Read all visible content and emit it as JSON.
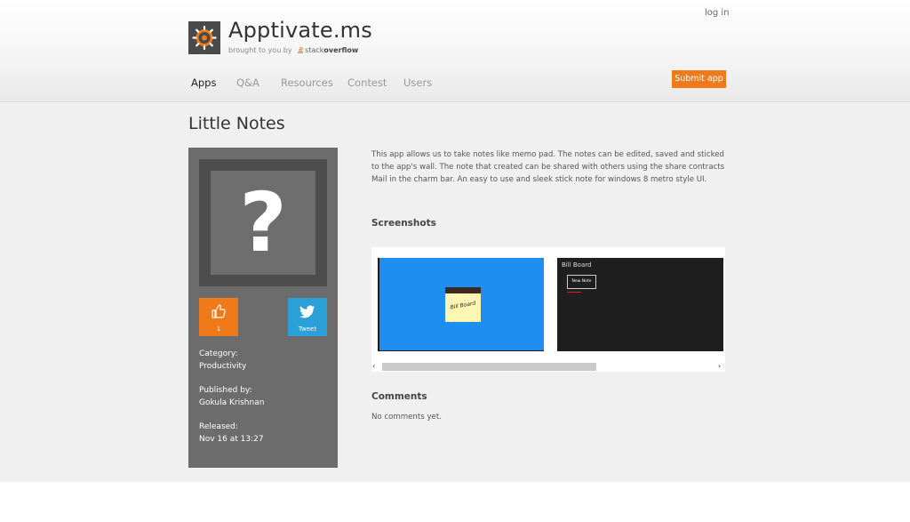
{
  "header": {
    "site_title": "Apptivate.ms",
    "brought_by": "brought to you by",
    "brand_stack": "stack",
    "brand_overflow": "overflow",
    "login": "log in",
    "logo_icon": "gear-icon",
    "nav": [
      {
        "label": "Apps",
        "active": true
      },
      {
        "label": "Q&A",
        "active": false
      },
      {
        "label": "Resources",
        "active": false
      },
      {
        "label": "Contest",
        "active": false
      },
      {
        "label": "Users",
        "active": false
      }
    ],
    "submit_label": "Submit app",
    "accent_color": "#f07a1a"
  },
  "app": {
    "title": "Little Notes",
    "placeholder_icon": "?",
    "likes": "1",
    "like_icon": "thumbs-up-icon",
    "tweet_label": "Tweet",
    "tweet_icon": "twitter-bird-icon",
    "category_label": "Category:",
    "category": "Productivity",
    "published_label": "Published by:",
    "publisher": "Gokula Krishnan",
    "released_label": "Released:",
    "released": "Nov 16 at 13:27",
    "description": "This app allows us to take notes like memo pad. The notes can be edited, saved and sticked to the app's wall. The note that created can be shared with others using the share contracts Mail in the charm bar. An easy to use and sleek stick note for windows 8 metro style UI."
  },
  "screenshots": {
    "heading": "Screenshots",
    "shot1_note_text": "Bill Board",
    "shot2_title": "Bill Board",
    "shot2_button": "New Note",
    "scroll_left": "‹",
    "scroll_right": "›"
  },
  "comments": {
    "heading": "Comments",
    "empty_text": "No comments yet."
  }
}
